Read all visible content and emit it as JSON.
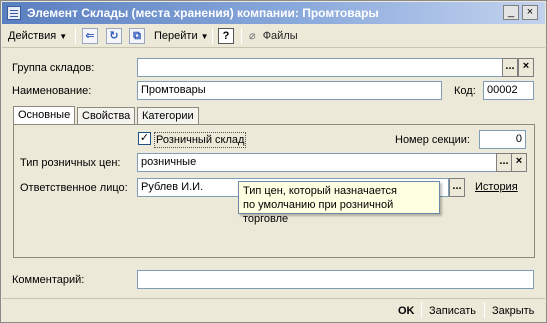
{
  "window": {
    "title": "Элемент Склады (места хранения) компании: Промтовары",
    "controls": {
      "minimize": "_",
      "close": "×"
    }
  },
  "toolbar": {
    "actions_label": "Действия",
    "goto_label": "Перейти",
    "help_label": "?",
    "files_label": "Файлы"
  },
  "form": {
    "group_label": "Группа складов:",
    "group_value": "",
    "group_select": "...",
    "group_clear": "×",
    "name_label": "Наименование:",
    "name_value": "Промтовары",
    "code_label": "Код:",
    "code_value": "00002"
  },
  "tabs": [
    {
      "label": "Основные"
    },
    {
      "label": "Свойства"
    },
    {
      "label": "Категории"
    }
  ],
  "main_tab": {
    "retail_checkbox_label": "Розничный склад",
    "retail_checked": "✓",
    "section_label": "Номер секции:",
    "section_value": "0",
    "price_type_label": "Тип розничных цен:",
    "price_type_value": "розничные",
    "price_select": "...",
    "price_clear": "×",
    "responsible_label": "Ответственное лицо:",
    "responsible_value": "Рублев И.И.",
    "responsible_select": "...",
    "history_link": "История"
  },
  "tooltip": {
    "line1": "Тип цен, который назначается",
    "line2": "по умолчанию при розничной торговле"
  },
  "comment": {
    "label": "Комментарий:",
    "value": ""
  },
  "footer": {
    "ok_label": "OK",
    "save_label": "Записать",
    "close_label": "Закрыть"
  }
}
